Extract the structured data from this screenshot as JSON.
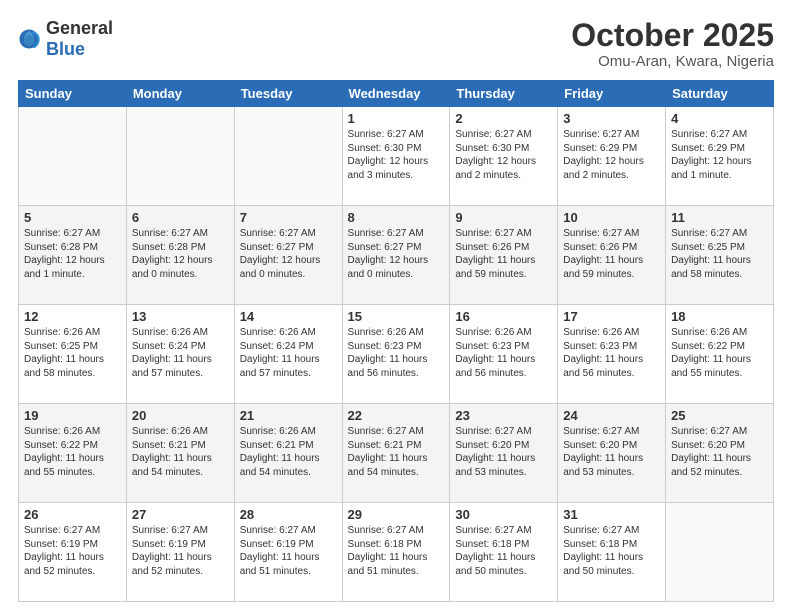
{
  "header": {
    "logo_general": "General",
    "logo_blue": "Blue",
    "month": "October 2025",
    "location": "Omu-Aran, Kwara, Nigeria"
  },
  "weekdays": [
    "Sunday",
    "Monday",
    "Tuesday",
    "Wednesday",
    "Thursday",
    "Friday",
    "Saturday"
  ],
  "weeks": [
    [
      {
        "day": "",
        "sunrise": "",
        "sunset": "",
        "daylight": "",
        "empty": true
      },
      {
        "day": "",
        "sunrise": "",
        "sunset": "",
        "daylight": "",
        "empty": true
      },
      {
        "day": "",
        "sunrise": "",
        "sunset": "",
        "daylight": "",
        "empty": true
      },
      {
        "day": "1",
        "sunrise": "Sunrise: 6:27 AM",
        "sunset": "Sunset: 6:30 PM",
        "daylight": "Daylight: 12 hours and 3 minutes."
      },
      {
        "day": "2",
        "sunrise": "Sunrise: 6:27 AM",
        "sunset": "Sunset: 6:30 PM",
        "daylight": "Daylight: 12 hours and 2 minutes."
      },
      {
        "day": "3",
        "sunrise": "Sunrise: 6:27 AM",
        "sunset": "Sunset: 6:29 PM",
        "daylight": "Daylight: 12 hours and 2 minutes."
      },
      {
        "day": "4",
        "sunrise": "Sunrise: 6:27 AM",
        "sunset": "Sunset: 6:29 PM",
        "daylight": "Daylight: 12 hours and 1 minute."
      }
    ],
    [
      {
        "day": "5",
        "sunrise": "Sunrise: 6:27 AM",
        "sunset": "Sunset: 6:28 PM",
        "daylight": "Daylight: 12 hours and 1 minute."
      },
      {
        "day": "6",
        "sunrise": "Sunrise: 6:27 AM",
        "sunset": "Sunset: 6:28 PM",
        "daylight": "Daylight: 12 hours and 0 minutes."
      },
      {
        "day": "7",
        "sunrise": "Sunrise: 6:27 AM",
        "sunset": "Sunset: 6:27 PM",
        "daylight": "Daylight: 12 hours and 0 minutes."
      },
      {
        "day": "8",
        "sunrise": "Sunrise: 6:27 AM",
        "sunset": "Sunset: 6:27 PM",
        "daylight": "Daylight: 12 hours and 0 minutes."
      },
      {
        "day": "9",
        "sunrise": "Sunrise: 6:27 AM",
        "sunset": "Sunset: 6:26 PM",
        "daylight": "Daylight: 11 hours and 59 minutes."
      },
      {
        "day": "10",
        "sunrise": "Sunrise: 6:27 AM",
        "sunset": "Sunset: 6:26 PM",
        "daylight": "Daylight: 11 hours and 59 minutes."
      },
      {
        "day": "11",
        "sunrise": "Sunrise: 6:27 AM",
        "sunset": "Sunset: 6:25 PM",
        "daylight": "Daylight: 11 hours and 58 minutes."
      }
    ],
    [
      {
        "day": "12",
        "sunrise": "Sunrise: 6:26 AM",
        "sunset": "Sunset: 6:25 PM",
        "daylight": "Daylight: 11 hours and 58 minutes."
      },
      {
        "day": "13",
        "sunrise": "Sunrise: 6:26 AM",
        "sunset": "Sunset: 6:24 PM",
        "daylight": "Daylight: 11 hours and 57 minutes."
      },
      {
        "day": "14",
        "sunrise": "Sunrise: 6:26 AM",
        "sunset": "Sunset: 6:24 PM",
        "daylight": "Daylight: 11 hours and 57 minutes."
      },
      {
        "day": "15",
        "sunrise": "Sunrise: 6:26 AM",
        "sunset": "Sunset: 6:23 PM",
        "daylight": "Daylight: 11 hours and 56 minutes."
      },
      {
        "day": "16",
        "sunrise": "Sunrise: 6:26 AM",
        "sunset": "Sunset: 6:23 PM",
        "daylight": "Daylight: 11 hours and 56 minutes."
      },
      {
        "day": "17",
        "sunrise": "Sunrise: 6:26 AM",
        "sunset": "Sunset: 6:23 PM",
        "daylight": "Daylight: 11 hours and 56 minutes."
      },
      {
        "day": "18",
        "sunrise": "Sunrise: 6:26 AM",
        "sunset": "Sunset: 6:22 PM",
        "daylight": "Daylight: 11 hours and 55 minutes."
      }
    ],
    [
      {
        "day": "19",
        "sunrise": "Sunrise: 6:26 AM",
        "sunset": "Sunset: 6:22 PM",
        "daylight": "Daylight: 11 hours and 55 minutes."
      },
      {
        "day": "20",
        "sunrise": "Sunrise: 6:26 AM",
        "sunset": "Sunset: 6:21 PM",
        "daylight": "Daylight: 11 hours and 54 minutes."
      },
      {
        "day": "21",
        "sunrise": "Sunrise: 6:26 AM",
        "sunset": "Sunset: 6:21 PM",
        "daylight": "Daylight: 11 hours and 54 minutes."
      },
      {
        "day": "22",
        "sunrise": "Sunrise: 6:27 AM",
        "sunset": "Sunset: 6:21 PM",
        "daylight": "Daylight: 11 hours and 54 minutes."
      },
      {
        "day": "23",
        "sunrise": "Sunrise: 6:27 AM",
        "sunset": "Sunset: 6:20 PM",
        "daylight": "Daylight: 11 hours and 53 minutes."
      },
      {
        "day": "24",
        "sunrise": "Sunrise: 6:27 AM",
        "sunset": "Sunset: 6:20 PM",
        "daylight": "Daylight: 11 hours and 53 minutes."
      },
      {
        "day": "25",
        "sunrise": "Sunrise: 6:27 AM",
        "sunset": "Sunset: 6:20 PM",
        "daylight": "Daylight: 11 hours and 52 minutes."
      }
    ],
    [
      {
        "day": "26",
        "sunrise": "Sunrise: 6:27 AM",
        "sunset": "Sunset: 6:19 PM",
        "daylight": "Daylight: 11 hours and 52 minutes."
      },
      {
        "day": "27",
        "sunrise": "Sunrise: 6:27 AM",
        "sunset": "Sunset: 6:19 PM",
        "daylight": "Daylight: 11 hours and 52 minutes."
      },
      {
        "day": "28",
        "sunrise": "Sunrise: 6:27 AM",
        "sunset": "Sunset: 6:19 PM",
        "daylight": "Daylight: 11 hours and 51 minutes."
      },
      {
        "day": "29",
        "sunrise": "Sunrise: 6:27 AM",
        "sunset": "Sunset: 6:18 PM",
        "daylight": "Daylight: 11 hours and 51 minutes."
      },
      {
        "day": "30",
        "sunrise": "Sunrise: 6:27 AM",
        "sunset": "Sunset: 6:18 PM",
        "daylight": "Daylight: 11 hours and 50 minutes."
      },
      {
        "day": "31",
        "sunrise": "Sunrise: 6:27 AM",
        "sunset": "Sunset: 6:18 PM",
        "daylight": "Daylight: 11 hours and 50 minutes."
      },
      {
        "day": "",
        "sunrise": "",
        "sunset": "",
        "daylight": "",
        "empty": true
      }
    ]
  ]
}
